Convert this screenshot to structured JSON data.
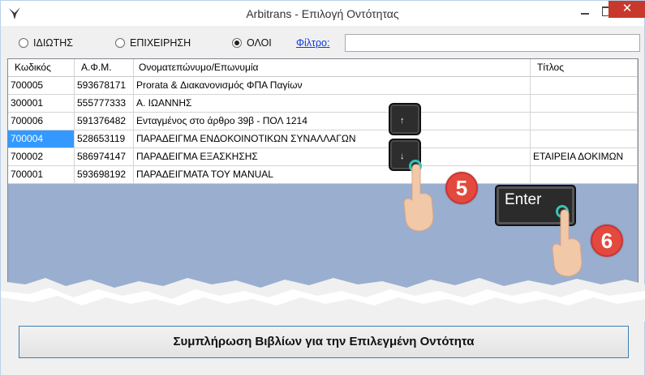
{
  "window": {
    "title": "Arbitrans - Επιλογή Οντότητας",
    "close_glyph": "✕"
  },
  "filters": {
    "radio_private": "ΙΔΙΩΤΗΣ",
    "radio_business": "ΕΠΙΧΕΙΡΗΣΗ",
    "radio_all": "ΟΛΟΙ",
    "selected": "ΟΛΟΙ",
    "filter_label": "Φίλτρο:",
    "filter_value": ""
  },
  "grid": {
    "columns": [
      "Κωδικός",
      "Α.Φ.Μ.",
      "Ονοματεπώνυμο/Επωνυμία",
      "Τίτλος"
    ],
    "rows": [
      [
        "700005",
        "593678171",
        "Prorata & Διακανονισμός ΦΠΑ Παγίων",
        ""
      ],
      [
        "300001",
        "555777333",
        "Α.  ΙΩΑΝΝΗΣ",
        ""
      ],
      [
        "700006",
        "591376482",
        "Ενταγμένος στο άρθρο 39β - ΠΟΛ 1214",
        ""
      ],
      [
        "700004",
        "528653119",
        "ΠΑΡΑΔΕΙΓΜΑ ΕΝΔΟΚΟΙΝΟΤΙΚΩΝ ΣΥΝΑΛΛΑΓΩΝ",
        ""
      ],
      [
        "700002",
        "586974147",
        "ΠΑΡΑΔΕΙΓΜΑ ΕΞΑΣΚΗΣΗΣ",
        "ΕΤΑΙΡΕΙΑ ΔΟΚΙΜΩΝ"
      ],
      [
        "700001",
        "593698192",
        "ΠΑΡΑΔΕΙΓΜΑΤΑ ΤΟΥ MANUAL",
        ""
      ]
    ],
    "selected_row": 3
  },
  "overlay": {
    "key_up": "↑",
    "key_down": "↓",
    "enter": "Enter",
    "step5": "5",
    "step6": "6"
  },
  "actions": {
    "fill_books": "Συμπλήρωση Βιβλίων για την Επιλεγμένη Οντότητα"
  },
  "colors": {
    "selection": "#3399ff",
    "grid_bg": "#9aaed0",
    "close_button": "#c7392d",
    "step_badge": "#e34a3d",
    "tap_ring": "#36c2b8"
  }
}
